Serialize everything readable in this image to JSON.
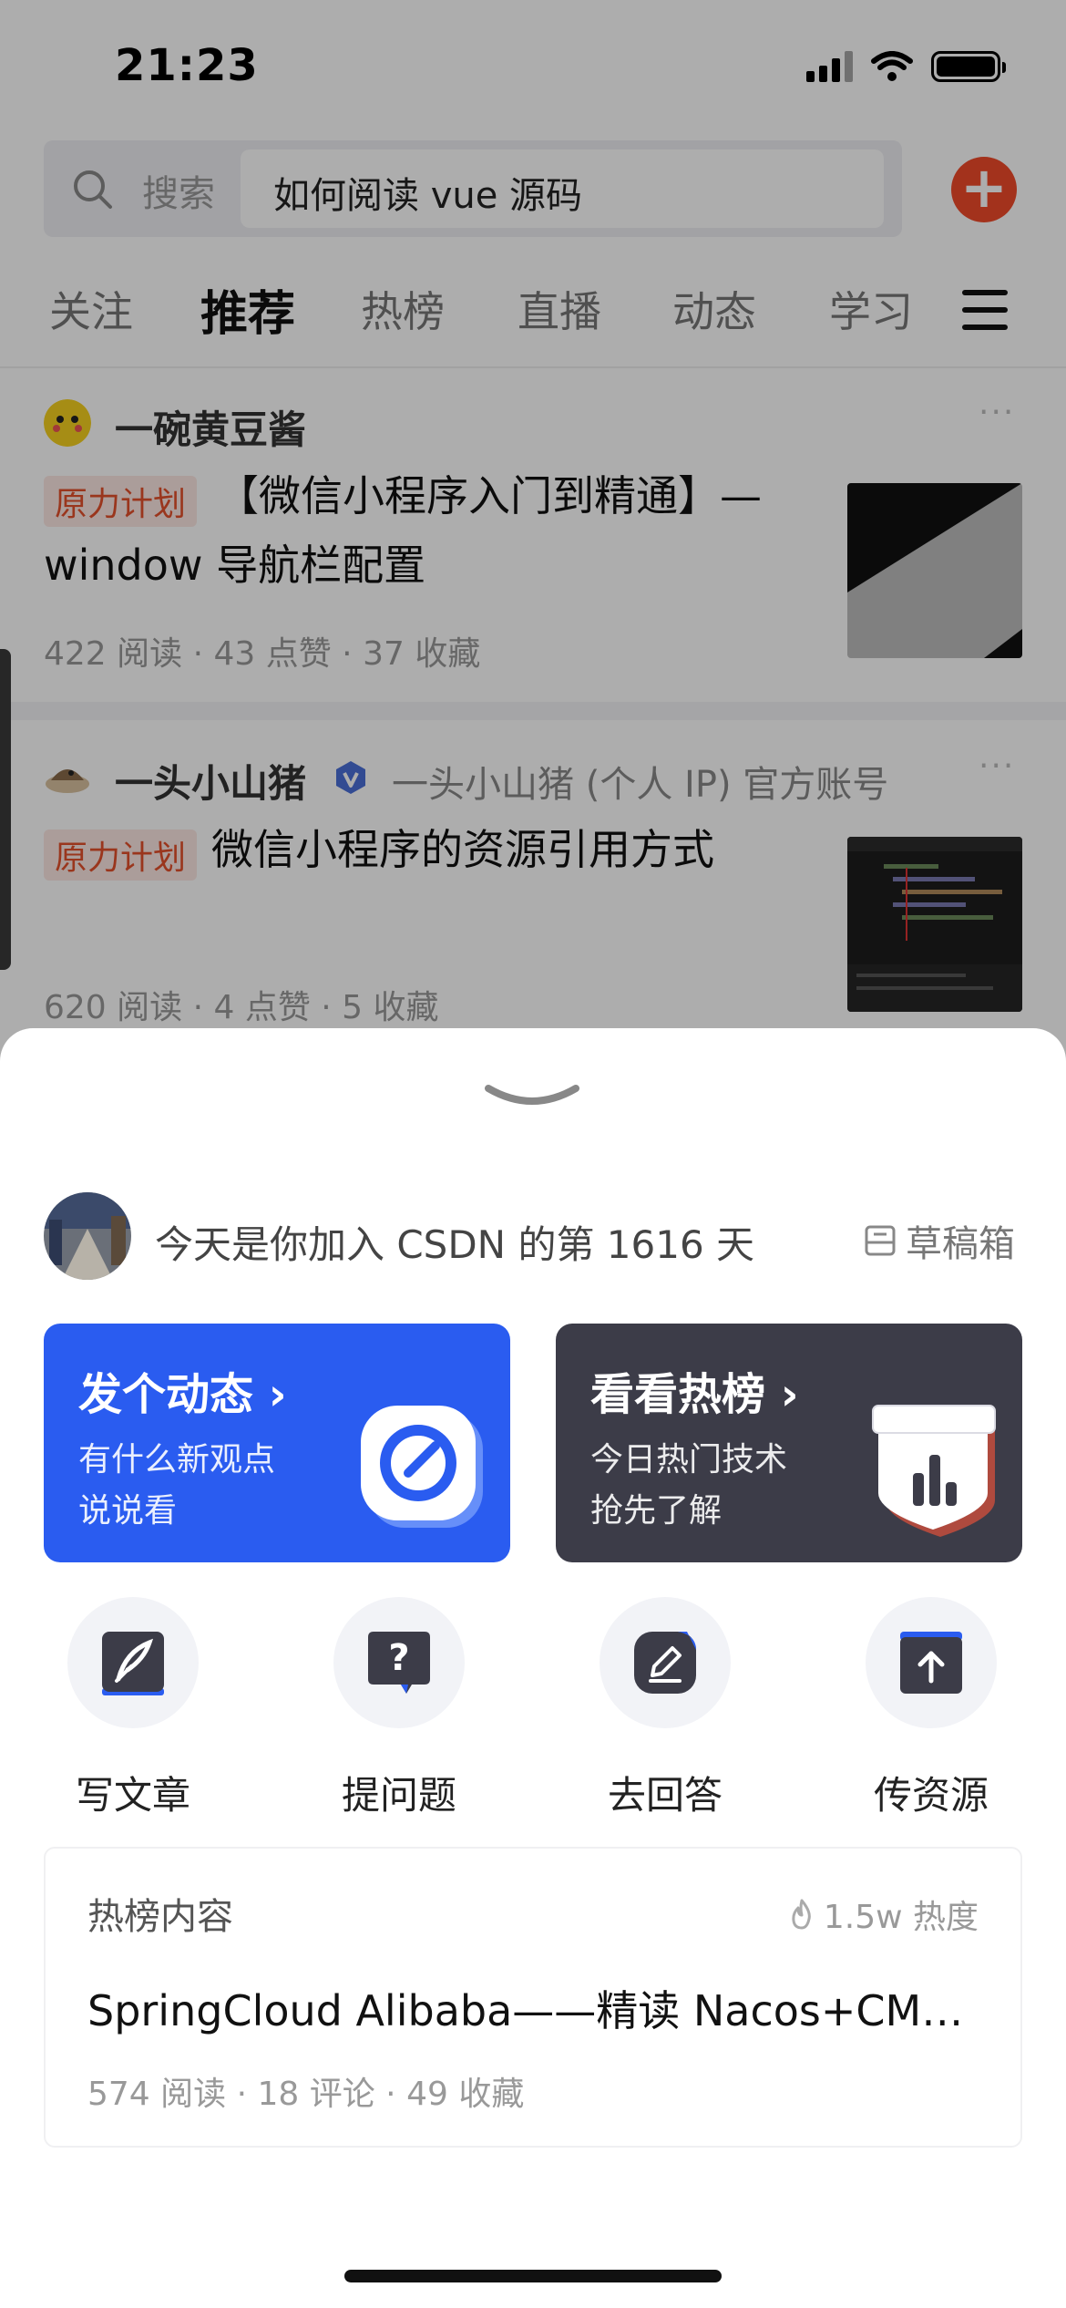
{
  "status_bar": {
    "time": "21:23"
  },
  "search": {
    "label": "搜索",
    "value": "如何阅读 vue 源码"
  },
  "add_button": {
    "symbol": "+"
  },
  "tabs": [
    {
      "label": "关注"
    },
    {
      "label": "推荐"
    },
    {
      "label": "热榜"
    },
    {
      "label": "直播"
    },
    {
      "label": "动态"
    },
    {
      "label": "学习"
    }
  ],
  "feed": [
    {
      "author": "一碗黄豆酱",
      "tag": "原力计划",
      "title_line1": "【微信小程序入门到精通】—",
      "title_line2": "window 导航栏配置",
      "stats": "422 阅读 · 43 点赞 · 37 收藏"
    },
    {
      "author": "一头小山猪",
      "official": "一头小山猪 (个人 IP) 官方账号",
      "tag": "原力计划",
      "title_line1": "微信小程序的资源引用方式",
      "stats": "620 阅读 · 4 点赞 · 5 收藏"
    }
  ],
  "more_symbol": "···",
  "sheet": {
    "welcome": "今天是你加入 CSDN 的第 1616 天",
    "draft": "草稿箱",
    "cards": [
      {
        "title": "发个动态 ›",
        "line1": "有什么新观点",
        "line2": "说说看"
      },
      {
        "title": "看看热榜 ›",
        "line1": "今日热门技术",
        "line2": "抢先了解"
      }
    ],
    "actions": [
      {
        "label": "写文章",
        "icon": "quill-icon"
      },
      {
        "label": "提问题",
        "icon": "question-icon"
      },
      {
        "label": "去回答",
        "icon": "edit-icon"
      },
      {
        "label": "传资源",
        "icon": "upload-icon"
      }
    ],
    "hot": {
      "header": "热榜内容",
      "heat": "1.5w 热度",
      "title": "SpringCloud Alibaba——精读 Nacos+CMDB+核心源码",
      "stats": "574 阅读 · 18 评论 · 49 收藏"
    }
  },
  "colors": {
    "accent_red": "#f04a2a",
    "card_blue": "#2a5cf0",
    "card_dark": "#3c3c48"
  }
}
